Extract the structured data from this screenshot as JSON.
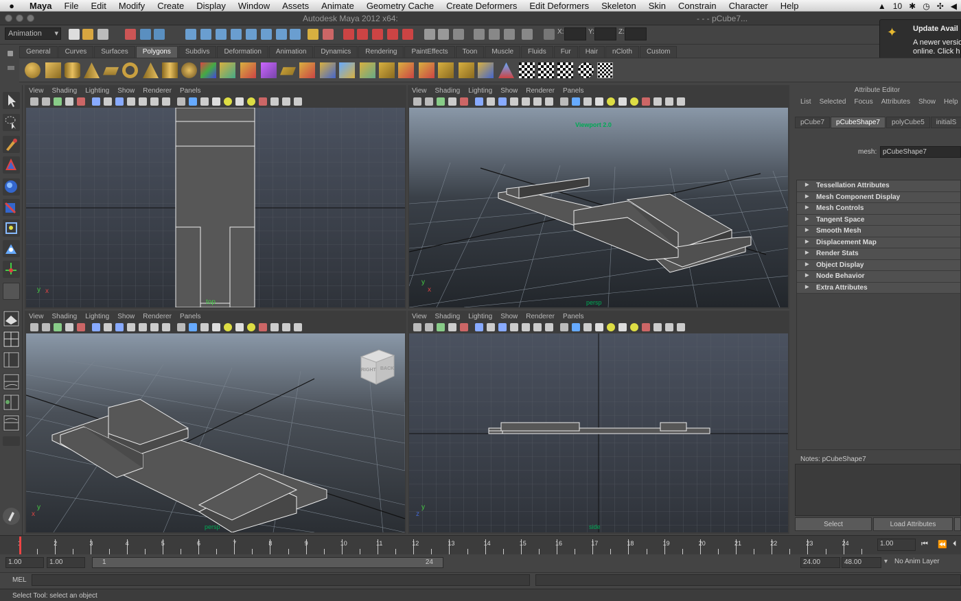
{
  "mac_menu": {
    "app": "Maya",
    "items": [
      "File",
      "Edit",
      "Modify",
      "Create",
      "Display",
      "Window",
      "Assets",
      "Animate",
      "Geometry Cache",
      "Create Deformers",
      "Edit Deformers",
      "Skeleton",
      "Skin",
      "Constrain",
      "Character",
      "Help"
    ],
    "right_number": "10"
  },
  "window": {
    "title": "Autodesk Maya 2012 x64:",
    "right_text": "- - -     pCube7..."
  },
  "status_line": {
    "mode": "Animation",
    "x_label": "X:",
    "y_label": "Y:",
    "z_label": "Z:"
  },
  "notification": {
    "title": "Update Avail",
    "line1": "A newer versio",
    "line2": "online. Click h"
  },
  "shelf": {
    "tabs": [
      "General",
      "Curves",
      "Surfaces",
      "Polygons",
      "Subdivs",
      "Deformation",
      "Animation",
      "Dynamics",
      "Rendering",
      "PaintEffects",
      "Toon",
      "Muscle",
      "Fluids",
      "Fur",
      "Hair",
      "nCloth",
      "Custom"
    ],
    "active_tab": "Polygons"
  },
  "viewport_menu": [
    "View",
    "Shading",
    "Lighting",
    "Show",
    "Renderer",
    "Panels"
  ],
  "viewports": {
    "top": {
      "camera_label": "top"
    },
    "persp_tr": {
      "overlay": "Viewport 2.0",
      "camera_label": "persp"
    },
    "persp_bl": {
      "camera_label": "persp",
      "cube_right": "RIGHT",
      "cube_back": "BACK"
    },
    "side": {
      "camera_label": "side"
    }
  },
  "attribute_editor": {
    "header": "Attribute Editor",
    "menu": [
      "List",
      "Selected",
      "Focus",
      "Attributes",
      "Show",
      "Help"
    ],
    "tabs": [
      "pCube7",
      "pCubeShape7",
      "polyCube5",
      "initialS"
    ],
    "active_tab": "pCubeShape7",
    "mesh_label": "mesh:",
    "mesh_value": "pCubeShape7",
    "sections": [
      "Tessellation Attributes",
      "Mesh Component Display",
      "Mesh Controls",
      "Tangent Space",
      "Smooth Mesh",
      "Displacement Map",
      "Render Stats",
      "Object Display",
      "Node Behavior",
      "Extra Attributes"
    ],
    "notes_label": "Notes:  pCubeShape7",
    "select_button": "Select",
    "load_button": "Load Attributes"
  },
  "time_slider": {
    "ticks": [
      "1",
      "2",
      "3",
      "4",
      "5",
      "6",
      "7",
      "8",
      "9",
      "10",
      "11",
      "12",
      "13",
      "14",
      "15",
      "16",
      "17",
      "18",
      "19",
      "20",
      "21",
      "22",
      "23",
      "24"
    ],
    "current_time": "1.00"
  },
  "range_slider": {
    "start": "1.00",
    "playback_start": "1.00",
    "slider_start": "1",
    "slider_end": "24",
    "playback_end": "24.00",
    "end": "48.00",
    "anim_layer": "No Anim Layer"
  },
  "command_line": {
    "label": "MEL"
  },
  "help_line": {
    "text": "Select Tool: select an object"
  }
}
